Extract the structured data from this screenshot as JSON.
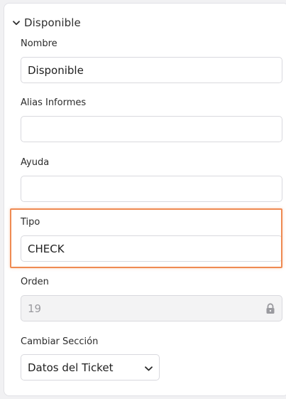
{
  "section": {
    "title": "Disponible",
    "icon": "chevron-down-icon"
  },
  "fields": {
    "nombre": {
      "label": "Nombre",
      "value": "Disponible"
    },
    "alias": {
      "label": "Alias Informes",
      "value": ""
    },
    "ayuda": {
      "label": "Ayuda",
      "value": ""
    },
    "tipo": {
      "label": "Tipo",
      "value": "CHECK"
    },
    "orden": {
      "label": "Orden",
      "value": "19",
      "icon": "lock-icon"
    },
    "seccion": {
      "label": "Cambiar Sección",
      "value": "Datos del Ticket",
      "icon": "chevron-down-icon"
    }
  },
  "colors": {
    "highlight": "#ef8a52",
    "border": "#d9d9de",
    "disabled_bg": "#f3f3f4"
  }
}
